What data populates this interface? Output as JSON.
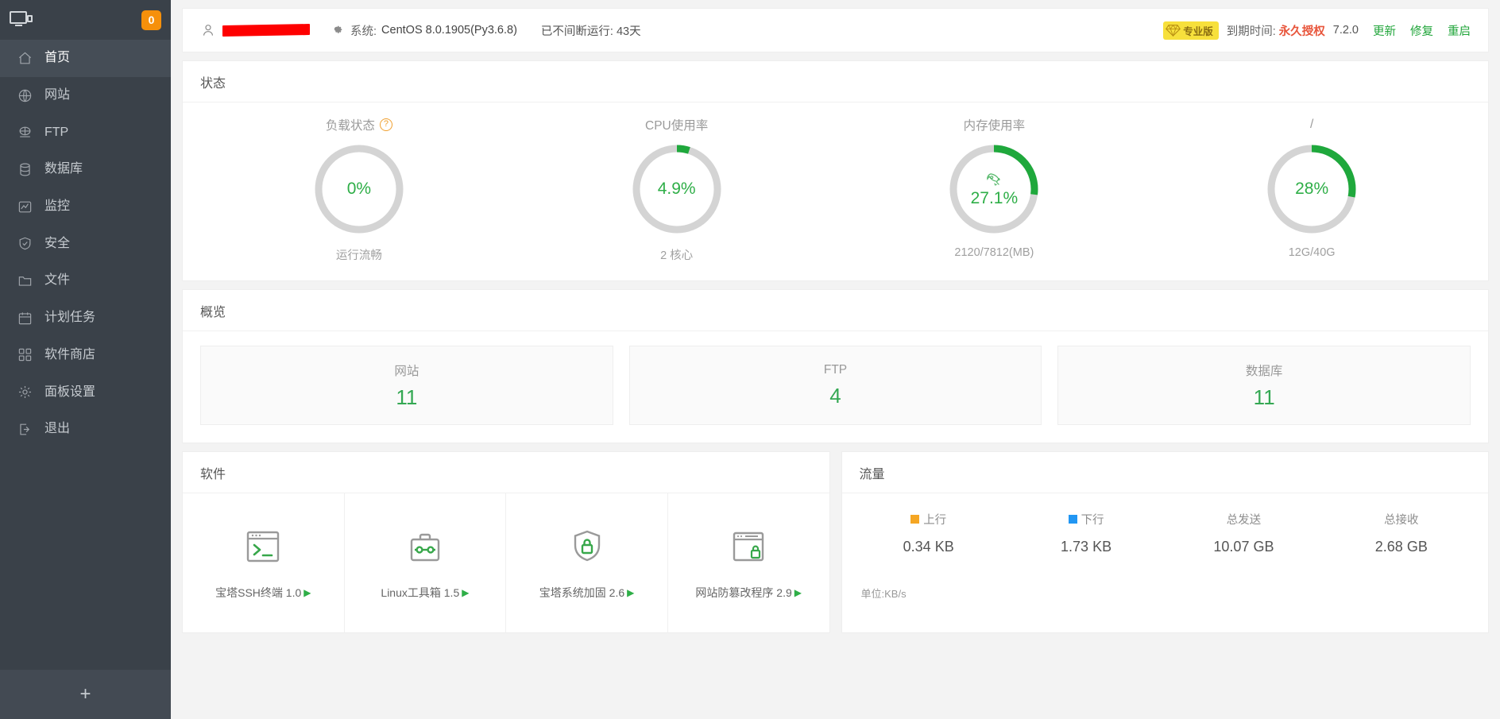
{
  "sidebar": {
    "brand_name_redacted": true,
    "notification_count": "0",
    "items": [
      {
        "label": "首页",
        "icon": "home-icon",
        "active": true
      },
      {
        "label": "网站",
        "icon": "globe-icon",
        "active": false
      },
      {
        "label": "FTP",
        "icon": "ftp-icon",
        "active": false
      },
      {
        "label": "数据库",
        "icon": "database-icon",
        "active": false
      },
      {
        "label": "监控",
        "icon": "chart-monitor-icon",
        "active": false
      },
      {
        "label": "安全",
        "icon": "shield-check-icon",
        "active": false
      },
      {
        "label": "文件",
        "icon": "folder-icon",
        "active": false
      },
      {
        "label": "计划任务",
        "icon": "calendar-icon",
        "active": false
      },
      {
        "label": "软件商店",
        "icon": "grid-apps-icon",
        "active": false
      },
      {
        "label": "面板设置",
        "icon": "gear-icon",
        "active": false
      },
      {
        "label": "退出",
        "icon": "logout-icon",
        "active": false
      }
    ],
    "add_label": "+"
  },
  "topbar": {
    "username_redacted": true,
    "system_label": "系统:",
    "system_value": "CentOS 8.0.1905(Py3.6.8)",
    "uptime": "已不间断运行: 43天",
    "pro_badge": "专业版",
    "expiry_label": "到期时间:",
    "expiry_value": "永久授权",
    "version": "7.2.0",
    "links": [
      "更新",
      "修复",
      "重启"
    ]
  },
  "status": {
    "title": "状态",
    "gauges": [
      {
        "title": "负载状态",
        "has_help": true,
        "value": "0%",
        "percent": 0,
        "footer": "运行流畅",
        "has_rocket": false
      },
      {
        "title": "CPU使用率",
        "has_help": false,
        "value": "4.9%",
        "percent": 4.9,
        "footer": "2 核心",
        "has_rocket": false
      },
      {
        "title": "内存使用率",
        "has_help": false,
        "value": "27.1%",
        "percent": 27.1,
        "footer": "2120/7812(MB)",
        "has_rocket": true
      },
      {
        "title": "/",
        "has_help": false,
        "value": "28%",
        "percent": 28,
        "footer": "12G/40G",
        "has_rocket": false
      }
    ]
  },
  "overview": {
    "title": "概览",
    "boxes": [
      {
        "label": "网站",
        "value": "11"
      },
      {
        "label": "FTP",
        "value": "4"
      },
      {
        "label": "数据库",
        "value": "11"
      }
    ]
  },
  "software": {
    "title": "软件",
    "items": [
      {
        "name": "宝塔SSH终端 1.0",
        "icon": "terminal-icon",
        "arrow": "▶"
      },
      {
        "name": "Linux工具箱 1.5",
        "icon": "toolbox-icon",
        "arrow": "▶"
      },
      {
        "name": "宝塔系统加固 2.6",
        "icon": "shield-lock-icon",
        "arrow": "▶"
      },
      {
        "name": "网站防篡改程序 2.9",
        "icon": "browser-lock-icon",
        "arrow": "▶"
      }
    ]
  },
  "traffic": {
    "title": "流量",
    "unit_note": "单位:KB/s",
    "columns": [
      {
        "label": "上行",
        "value": "0.34 KB",
        "swatch": "#f5a623"
      },
      {
        "label": "下行",
        "value": "1.73 KB",
        "swatch": "#2196f3"
      },
      {
        "label": "总发送",
        "value": "10.07 GB",
        "swatch": ""
      },
      {
        "label": "总接收",
        "value": "2.68 GB",
        "swatch": ""
      }
    ]
  },
  "colors": {
    "sidebar_bg": "#3a4149",
    "accent_green": "#1fa83c",
    "badge_orange": "#f6900b",
    "pro_yellow": "#f7e03c",
    "expiry_red": "#e8553b"
  }
}
